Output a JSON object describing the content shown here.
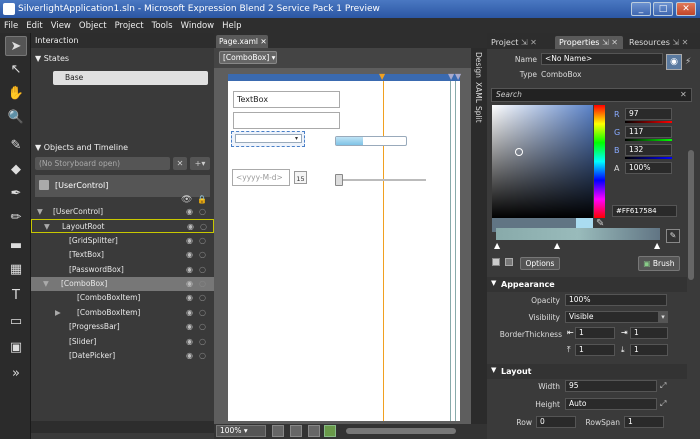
{
  "window": {
    "title": "SilverlightApplication1.sln - Microsoft Expression Blend 2 Service Pack 1 Preview",
    "min": "_",
    "max": "□",
    "close": "✕"
  },
  "menu": [
    "File",
    "Edit",
    "View",
    "Object",
    "Project",
    "Tools",
    "Window",
    "Help"
  ],
  "interaction": {
    "title": "Interaction",
    "states_title": "States",
    "base_state": "Base",
    "objects_title": "Objects and Timeline",
    "storyboard": "(No Storyboard open)",
    "root_label": "[UserControl]"
  },
  "tree": [
    {
      "label": "[UserControl]",
      "indent": 0
    },
    {
      "label": "LayoutRoot",
      "indent": 1
    },
    {
      "label": "[GridSplitter]",
      "indent": 2
    },
    {
      "label": "[TextBox]",
      "indent": 2
    },
    {
      "label": "[PasswordBox]",
      "indent": 2
    },
    {
      "label": "[ComboBox]",
      "indent": 1
    },
    {
      "label": "[ComboBoxItem]",
      "indent": 3
    },
    {
      "label": "[ComboBoxItem]",
      "indent": 3
    },
    {
      "label": "[ProgressBar]",
      "indent": 2
    },
    {
      "label": "[Slider]",
      "indent": 2
    },
    {
      "label": "[DatePicker]",
      "indent": 2
    }
  ],
  "document": {
    "tab": "Page.xaml",
    "breadcrumb": "[ComboBox]",
    "textbox_text": "TextBox",
    "date_placeholder": "<yyyy-M-d>",
    "calendar_day": "15",
    "zoom": "100%"
  },
  "side_tabs": [
    "Design",
    "XAML",
    "Split"
  ],
  "panels": {
    "project": "Project",
    "properties": "Properties",
    "resources": "Resources"
  },
  "properties": {
    "name_label": "Name",
    "name_value": "<No Name>",
    "type_label": "Type",
    "type_value": "ComboBox",
    "search": "Search",
    "color": {
      "r_label": "R",
      "r": "97",
      "g_label": "G",
      "g": "117",
      "b_label": "B",
      "b": "132",
      "a_label": "A",
      "a": "100%",
      "hex": "#FF617584",
      "accent": "#617584"
    },
    "options_button": "Options",
    "brush_button": "Brush"
  },
  "appearance": {
    "title": "Appearance",
    "opacity_label": "Opacity",
    "opacity": "100%",
    "visibility_label": "Visibility",
    "visibility": "Visible",
    "border_label": "BorderThickness",
    "b1": "1",
    "b2": "1",
    "b3": "1",
    "b4": "1"
  },
  "layout": {
    "title": "Layout",
    "width_label": "Width",
    "width": "95",
    "height_label": "Height",
    "height": "Auto",
    "row_label": "Row",
    "row": "0",
    "rowspan_label": "RowSpan",
    "rowspan": "1"
  }
}
